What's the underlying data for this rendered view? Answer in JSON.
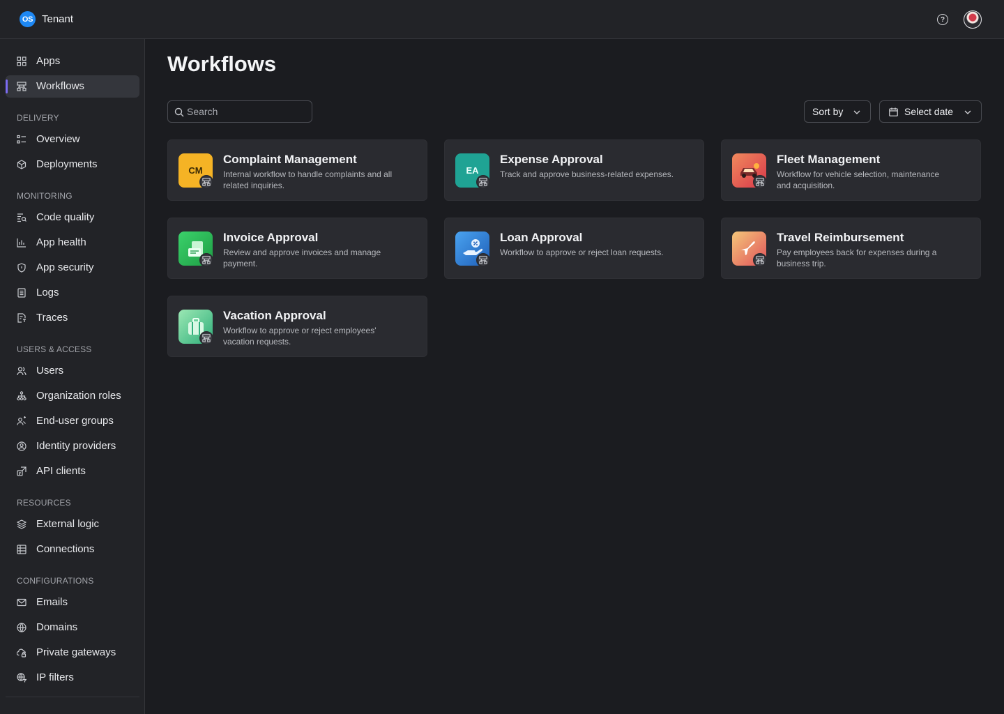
{
  "topbar": {
    "logo_text": "OS",
    "tenant_name": "Tenant",
    "help_icon": "question-circle-icon",
    "avatar_icon": "user-avatar"
  },
  "sidebar": {
    "top_items": [
      {
        "label": "Apps",
        "icon": "grid-icon"
      },
      {
        "label": "Workflows",
        "icon": "workflow-icon",
        "active": true
      }
    ],
    "sections": [
      {
        "title": "DELIVERY",
        "items": [
          {
            "label": "Overview",
            "icon": "list-icon"
          },
          {
            "label": "Deployments",
            "icon": "cube-icon"
          }
        ]
      },
      {
        "title": "MONITORING",
        "items": [
          {
            "label": "Code quality",
            "icon": "code-quality-icon"
          },
          {
            "label": "App health",
            "icon": "bar-chart-icon"
          },
          {
            "label": "App security",
            "icon": "shield-icon"
          },
          {
            "label": "Logs",
            "icon": "document-icon"
          },
          {
            "label": "Traces",
            "icon": "trace-icon"
          }
        ]
      },
      {
        "title": "USERS & ACCESS",
        "items": [
          {
            "label": "Users",
            "icon": "users-icon"
          },
          {
            "label": "Organization roles",
            "icon": "org-roles-icon"
          },
          {
            "label": "End-user groups",
            "icon": "groups-icon"
          },
          {
            "label": "Identity providers",
            "icon": "identity-icon"
          },
          {
            "label": "API clients",
            "icon": "api-clients-icon"
          }
        ]
      },
      {
        "title": "RESOURCES",
        "items": [
          {
            "label": "External logic",
            "icon": "layers-icon"
          },
          {
            "label": "Connections",
            "icon": "connections-icon"
          }
        ]
      },
      {
        "title": "CONFIGURATIONS",
        "items": [
          {
            "label": "Emails",
            "icon": "mail-icon"
          },
          {
            "label": "Domains",
            "icon": "globe-icon"
          },
          {
            "label": "Private gateways",
            "icon": "cloud-lock-icon"
          },
          {
            "label": "IP filters",
            "icon": "globe-filter-icon"
          }
        ]
      }
    ]
  },
  "main": {
    "title": "Workflows",
    "search_placeholder": "Search",
    "sort_label": "Sort by",
    "date_label": "Select date",
    "cards": [
      {
        "title": "Complaint Management",
        "desc": "Internal workflow to handle complaints and all related inquiries.",
        "icon_text": "CM",
        "icon_bg": "#f5b325",
        "icon_fg": "#3a2a05"
      },
      {
        "title": "Expense Approval",
        "desc": "Track and approve business-related expenses.",
        "icon_text": "EA",
        "icon_bg": "#1fa394",
        "icon_fg": "#e9fffb"
      },
      {
        "title": "Fleet Management",
        "desc": "Workflow for vehicle selection, maintenance and acquisition.",
        "icon_text": "",
        "icon_bg": "#e5534b",
        "icon_fg": "#ffffff"
      },
      {
        "title": "Invoice Approval",
        "desc": "Review and approve invoices and manage payment.",
        "icon_text": "",
        "icon_bg": "#2fbf55",
        "icon_fg": "#ffffff"
      },
      {
        "title": "Loan Approval",
        "desc": "Workflow to approve or reject loan requests.",
        "icon_text": "",
        "icon_bg": "#2f7fd6",
        "icon_fg": "#ffffff"
      },
      {
        "title": "Travel Reimbursement",
        "desc": "Pay employees back for expenses during a business trip.",
        "icon_text": "",
        "icon_bg": "#e86a5c",
        "icon_fg": "#ffffff"
      },
      {
        "title": "Vacation Approval",
        "desc": "Workflow to approve or reject employees' vacation requests.",
        "icon_text": "",
        "icon_bg": "#4fc98a",
        "icon_fg": "#ffffff"
      }
    ]
  },
  "colors": {
    "accent": "#7c6cf2",
    "brand": "#1e88f4",
    "background": "#1b1c20",
    "surface": "#2a2b30"
  }
}
